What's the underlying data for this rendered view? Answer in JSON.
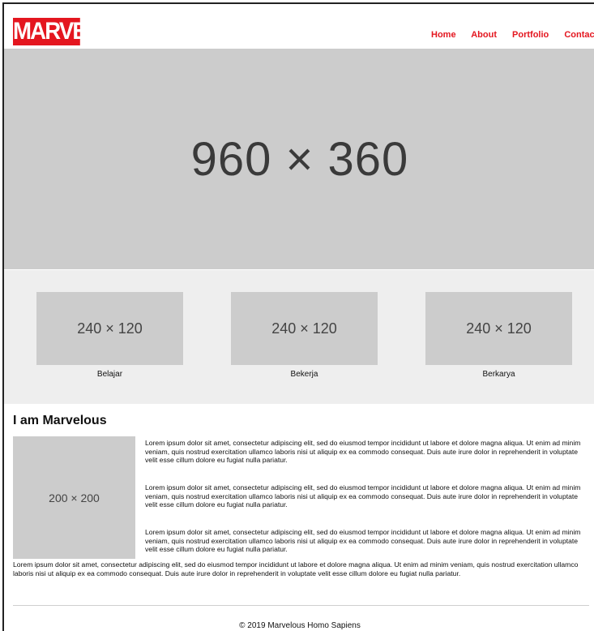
{
  "header": {
    "logo_text": "MARVEL",
    "nav": [
      "Home",
      "About",
      "Portfolio",
      "Contact"
    ]
  },
  "hero": {
    "placeholder": "960 × 360"
  },
  "features": [
    {
      "placeholder": "240 × 120",
      "caption": "Belajar"
    },
    {
      "placeholder": "240 × 120",
      "caption": "Bekerja"
    },
    {
      "placeholder": "240 × 120",
      "caption": "Berkarya"
    }
  ],
  "about": {
    "title": "I am Marvelous",
    "image_placeholder": "200 × 200",
    "paragraphs": [
      "Lorem ipsum dolor sit amet, consectetur adipiscing elit, sed do eiusmod tempor incididunt ut labore et dolore magna aliqua. Ut enim ad minim veniam, quis nostrud exercitation ullamco laboris nisi ut aliquip ex ea commodo consequat. Duis aute irure dolor in reprehenderit in voluptate velit esse cillum dolore eu fugiat nulla pariatur.",
      "Lorem ipsum dolor sit amet, consectetur adipiscing elit, sed do eiusmod tempor incididunt ut labore et dolore magna aliqua. Ut enim ad minim veniam, quis nostrud exercitation ullamco laboris nisi ut aliquip ex ea commodo consequat. Duis aute irure dolor in reprehenderit in voluptate velit esse cillum dolore eu fugiat nulla pariatur.",
      "Lorem ipsum dolor sit amet, consectetur adipiscing elit, sed do eiusmod tempor incididunt ut labore et dolore magna aliqua. Ut enim ad minim veniam, quis nostrud exercitation ullamco laboris nisi ut aliquip ex ea commodo consequat. Duis aute irure dolor in reprehenderit in voluptate velit esse cillum dolore eu fugiat nulla pariatur.",
      "Lorem ipsum dolor sit amet, consectetur adipiscing elit, sed do eiusmod tempor incididunt ut labore et dolore magna aliqua. Ut enim ad minim veniam, quis nostrud exercitation ullamco laboris nisi ut aliquip ex ea commodo consequat. Duis aute irure dolor in reprehenderit in voluptate velit esse cillum dolore eu fugiat nulla pariatur."
    ]
  },
  "footer": {
    "text": "© 2019 Marvelous Homo Sapiens"
  },
  "colors": {
    "brand": "#e4161f",
    "placeholder": "#cccccc",
    "section_bg": "#eeeeee"
  }
}
